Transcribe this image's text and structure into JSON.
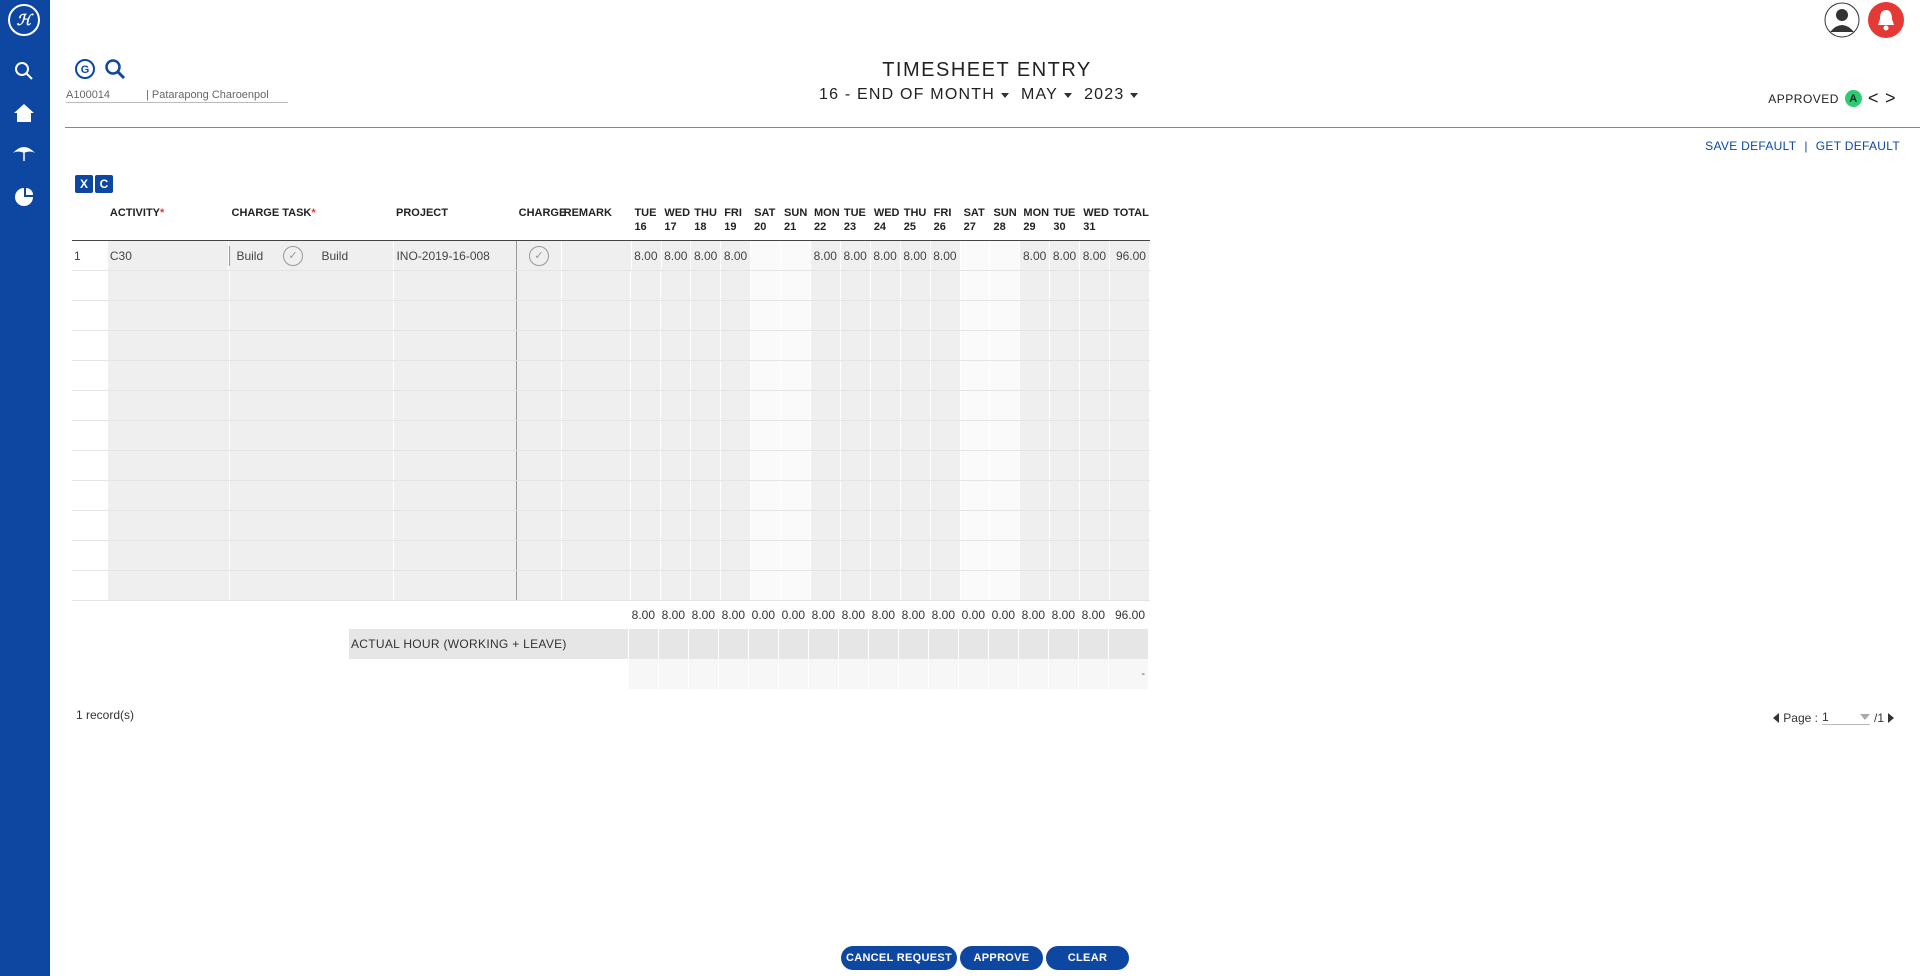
{
  "app": {
    "logo_text": "ℋ"
  },
  "page": {
    "title": "TIMESHEET ENTRY"
  },
  "period": {
    "range": "16 - END OF MONTH",
    "month": "MAY",
    "year": "2023"
  },
  "status": {
    "label": "APPROVED",
    "badge": "A",
    "prev": "<",
    "next": ">"
  },
  "employee": {
    "id": "A100014",
    "name": "| Patarapong Charoenpol"
  },
  "defaults": {
    "save": "SAVE DEFAULT",
    "sep": "|",
    "get": "GET DEFAULT"
  },
  "exports": {
    "excel": "X",
    "csv": "C"
  },
  "table": {
    "headers": {
      "activity": "ACTIVITY",
      "required_mark": "*",
      "charge_task": "CHARGE TASK",
      "project": "PROJECT",
      "charge": "CHARGE",
      "remark": "REMARK",
      "total": "TOTAL"
    },
    "days": [
      {
        "dow": "TUE",
        "d": "16"
      },
      {
        "dow": "WED",
        "d": "17"
      },
      {
        "dow": "THU",
        "d": "18"
      },
      {
        "dow": "FRI",
        "d": "19"
      },
      {
        "dow": "SAT",
        "d": "20"
      },
      {
        "dow": "SUN",
        "d": "21"
      },
      {
        "dow": "MON",
        "d": "22"
      },
      {
        "dow": "TUE",
        "d": "23"
      },
      {
        "dow": "WED",
        "d": "24"
      },
      {
        "dow": "THU",
        "d": "25"
      },
      {
        "dow": "FRI",
        "d": "26"
      },
      {
        "dow": "SAT",
        "d": "27"
      },
      {
        "dow": "SUN",
        "d": "28"
      },
      {
        "dow": "MON",
        "d": "29"
      },
      {
        "dow": "TUE",
        "d": "30"
      },
      {
        "dow": "WED",
        "d": "31"
      }
    ],
    "rows": [
      {
        "no": "1",
        "activity": "C30",
        "charge_task_code": "Build",
        "charge_task": "Build",
        "project": "INO-2019-16-008",
        "hours": [
          "8.00",
          "8.00",
          "8.00",
          "8.00",
          "",
          "",
          "8.00",
          "8.00",
          "8.00",
          "8.00",
          "8.00",
          "",
          "",
          "8.00",
          "8.00",
          "8.00"
        ],
        "total": "96.00"
      }
    ],
    "empty_rows": 11,
    "totals": [
      "8.00",
      "8.00",
      "8.00",
      "8.00",
      "0.00",
      "0.00",
      "8.00",
      "8.00",
      "8.00",
      "8.00",
      "8.00",
      "0.00",
      "0.00",
      "8.00",
      "8.00",
      "8.00"
    ],
    "grand_total": "96.00",
    "actual_hour_label": "ACTUAL HOUR (WORKING + LEAVE)",
    "remark_total": "-"
  },
  "records": "1 record(s)",
  "pager": {
    "label": "Page :",
    "current": "1",
    "of": "/1"
  },
  "buttons": {
    "cancel": "CANCEL REQUEST",
    "approve": "APPROVE",
    "clear": "CLEAR"
  }
}
